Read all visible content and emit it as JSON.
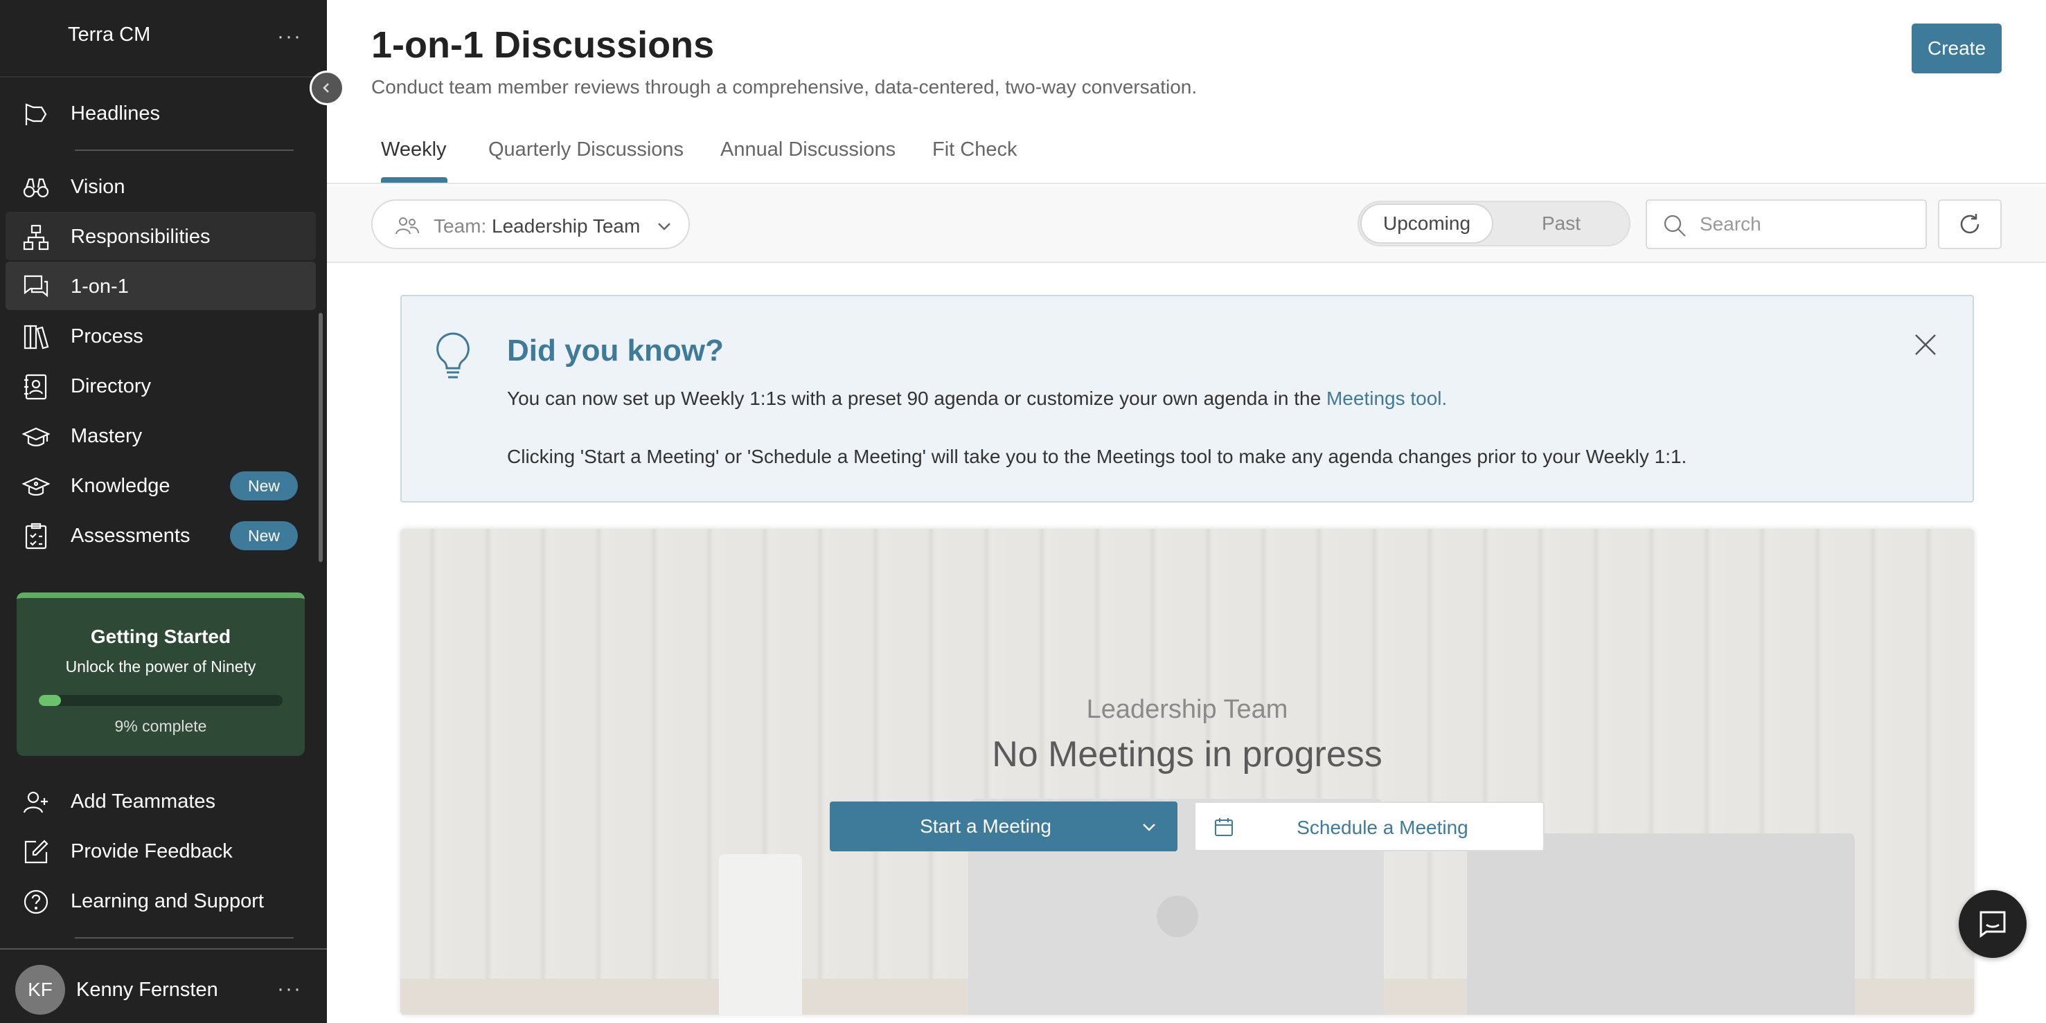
{
  "workspace": {
    "name": "Terra CM"
  },
  "sidebar": {
    "items": [
      {
        "label": "Headlines",
        "icon": "flag-icon"
      },
      {
        "label": "Vision",
        "icon": "binoculars-icon"
      },
      {
        "label": "Responsibilities",
        "icon": "org-chart-icon"
      },
      {
        "label": "1-on-1",
        "icon": "chat-bubbles-icon"
      },
      {
        "label": "Process",
        "icon": "books-icon"
      },
      {
        "label": "Directory",
        "icon": "contact-card-icon"
      },
      {
        "label": "Mastery",
        "icon": "graduation-cap-icon"
      },
      {
        "label": "Knowledge",
        "icon": "mortarboard-icon",
        "badge": "New"
      },
      {
        "label": "Assessments",
        "icon": "clipboard-icon",
        "badge": "New"
      }
    ],
    "getting_started": {
      "title": "Getting Started",
      "subtitle": "Unlock the power of Ninety",
      "progress_label": "9% complete",
      "progress": 0.09
    },
    "footer_items": [
      {
        "label": "Add Teammates",
        "icon": "add-user-icon"
      },
      {
        "label": "Provide Feedback",
        "icon": "edit-icon"
      },
      {
        "label": "Learning and Support",
        "icon": "help-icon"
      }
    ],
    "user": {
      "initials": "KF",
      "name": "Kenny Fernsten"
    }
  },
  "header": {
    "title": "1-on-1 Discussions",
    "subtitle": "Conduct team member reviews through a comprehensive, data-centered, two-way conversation.",
    "create_label": "Create"
  },
  "tabs": [
    {
      "label": "Weekly",
      "active": true
    },
    {
      "label": "Quarterly Discussions"
    },
    {
      "label": "Annual Discussions"
    },
    {
      "label": "Fit Check"
    }
  ],
  "toolbar": {
    "team_prefix": "Team:",
    "team_value": "Leadership Team",
    "toggle": {
      "on": "Upcoming",
      "off": "Past"
    },
    "search_placeholder": "Search"
  },
  "tip": {
    "title": "Did you know?",
    "line1_prefix": "You can now set up Weekly 1:1s with a preset 90 agenda or customize your own agenda in the ",
    "line1_link": "Meetings tool.",
    "line2": "Clicking 'Start a Meeting' or 'Schedule a Meeting' will take you to the Meetings tool to make any agenda changes prior to your Weekly 1:1."
  },
  "hero": {
    "team": "Leadership Team",
    "status": "No Meetings in progress",
    "start_label": "Start a Meeting",
    "schedule_label": "Schedule a Meeting"
  },
  "colors": {
    "accent": "#3e7a99",
    "sidebar_bg": "#222222",
    "progress_green": "#6cc26c"
  }
}
